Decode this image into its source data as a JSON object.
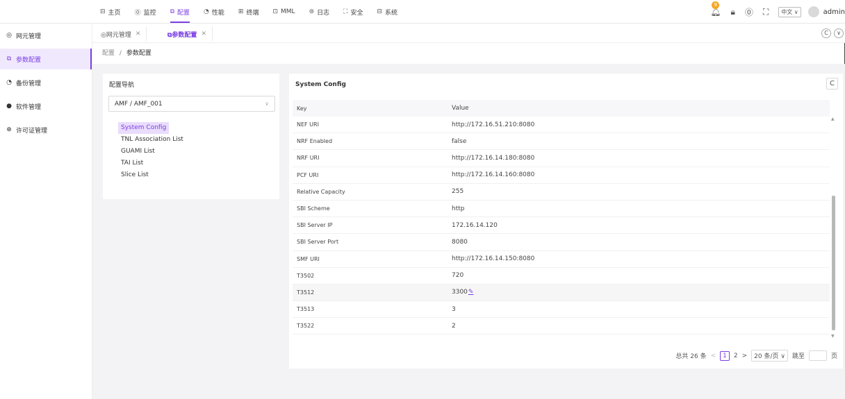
{
  "topnav": [
    {
      "icon": "home-icon",
      "glyph": "⊟",
      "label": "主页"
    },
    {
      "icon": "monitor-icon",
      "glyph": "⓪",
      "label": "监控"
    },
    {
      "icon": "config-icon",
      "glyph": "⧉",
      "label": "配置",
      "active": true
    },
    {
      "icon": "performance-icon",
      "glyph": "◔",
      "label": "性能"
    },
    {
      "icon": "terminal-icon",
      "glyph": "⊞",
      "label": "终端"
    },
    {
      "icon": "mml-icon",
      "glyph": "⊡",
      "label": "MML"
    },
    {
      "icon": "log-icon",
      "glyph": "⊜",
      "label": "日志"
    },
    {
      "icon": "security-icon",
      "glyph": "⛶",
      "label": "安全"
    },
    {
      "icon": "system-icon",
      "glyph": "⊟",
      "label": "系统"
    }
  ],
  "topright": {
    "notification_count": "9",
    "language": "中文",
    "user": "admin"
  },
  "sidebar": [
    {
      "icon": "network-element-icon",
      "glyph": "◎",
      "label": "网元管理"
    },
    {
      "icon": "param-config-icon",
      "glyph": "⧉",
      "label": "参数配置",
      "active": true
    },
    {
      "icon": "backup-icon",
      "glyph": "◔",
      "label": "备份管理"
    },
    {
      "icon": "software-icon",
      "glyph": "●",
      "label": "软件管理"
    },
    {
      "icon": "license-icon",
      "glyph": "⊕",
      "label": "许可证管理"
    }
  ],
  "tabs": [
    {
      "label": "◎网元管理"
    },
    {
      "label": "⧉参数配置",
      "active": true
    }
  ],
  "breadcrumb": {
    "parent": "配置",
    "sep": "/",
    "current": "参数配置"
  },
  "nav_panel": {
    "title": "配置导航",
    "selected": "AMF / AMF_001",
    "items": [
      "System Config",
      "TNL Association List",
      "GUAMI List",
      "TAI List",
      "Slice List"
    ]
  },
  "config_panel": {
    "title": "System Config",
    "columns": [
      "Key",
      "Value"
    ],
    "rows": [
      {
        "key": "NEF URI",
        "value": "http://172.16.51.210:8080"
      },
      {
        "key": "NRF Enabled",
        "value": "false"
      },
      {
        "key": "NRF URI",
        "value": "http://172.16.14.180:8080"
      },
      {
        "key": "PCF URI",
        "value": "http://172.16.14.160:8080"
      },
      {
        "key": "Relative Capacity",
        "value": "255"
      },
      {
        "key": "SBI Scheme",
        "value": "http"
      },
      {
        "key": "SBI Server IP",
        "value": "172.16.14.120"
      },
      {
        "key": "SBI Server Port",
        "value": "8080"
      },
      {
        "key": "SMF URI",
        "value": "http://172.16.14.150:8080"
      },
      {
        "key": "T3502",
        "value": "720"
      },
      {
        "key": "T3512",
        "value": "3300",
        "editing": true
      },
      {
        "key": "T3513",
        "value": "3"
      },
      {
        "key": "T3522",
        "value": "2"
      }
    ]
  },
  "pagination": {
    "total": "总共 26 条",
    "pages": [
      "1",
      "2"
    ],
    "current": "1",
    "page_size": "20 条/页",
    "jump_label": "跳至",
    "page_suffix": "页"
  }
}
